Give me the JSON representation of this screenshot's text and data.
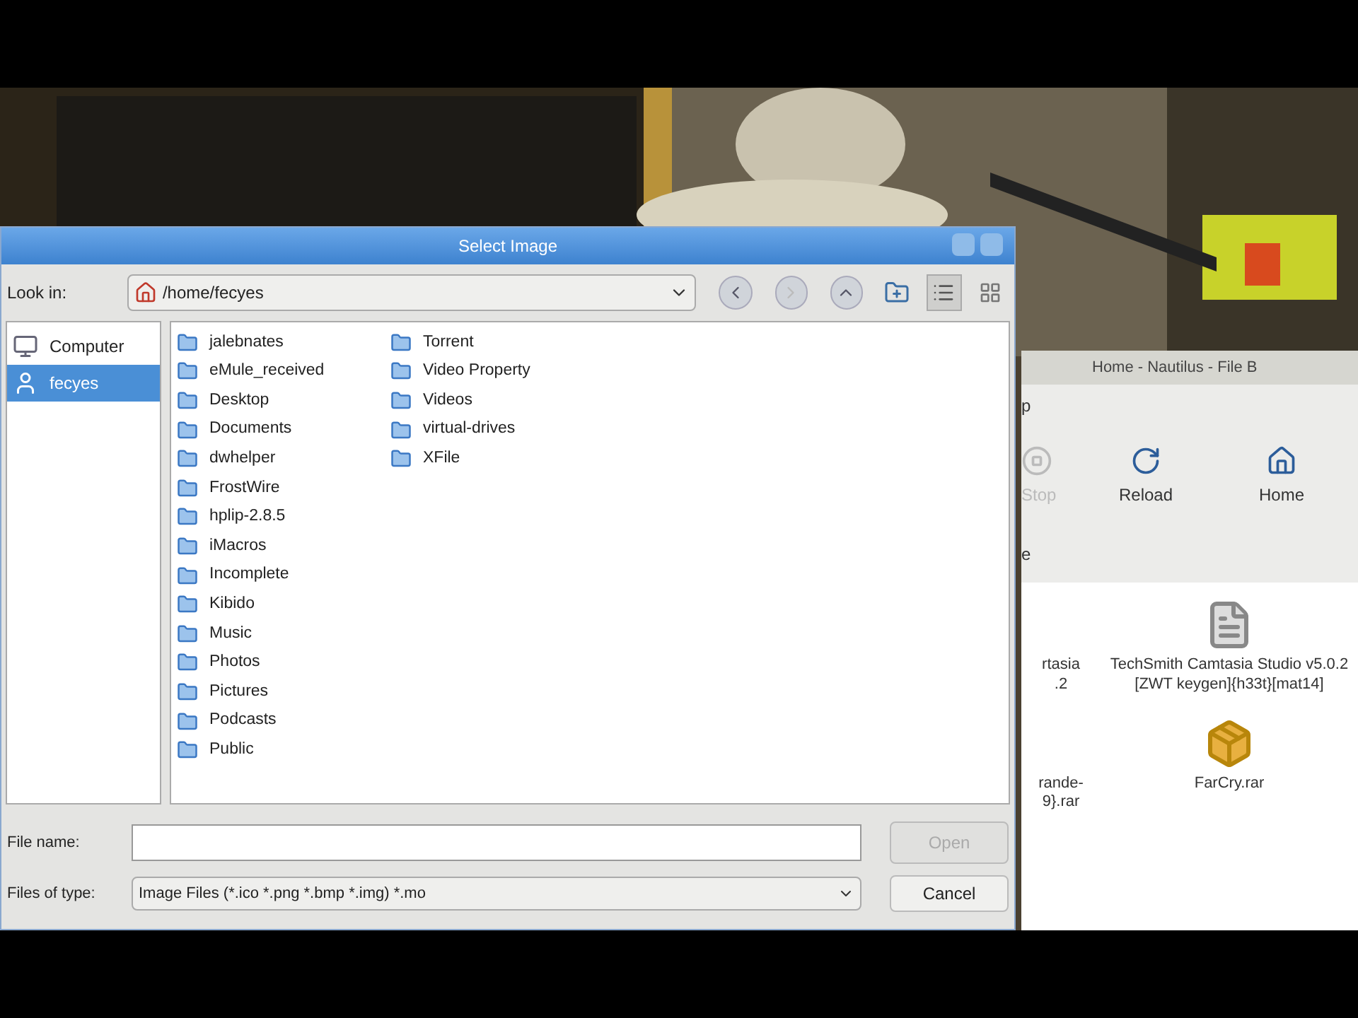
{
  "dialog": {
    "title": "Select Image",
    "look_in_label": "Look in:",
    "path": "/home/fecyes",
    "sidebar": [
      {
        "label": "Computer",
        "kind": "computer",
        "selected": false
      },
      {
        "label": "fecyes",
        "kind": "user",
        "selected": true
      }
    ],
    "columns": [
      [
        "jalebnates",
        "eMule_received",
        "Desktop",
        "Documents",
        "dwhelper",
        "FrostWire",
        "hplip-2.8.5",
        "iMacros",
        "Incomplete",
        "Kibido",
        "Music",
        "Photos",
        "Pictures",
        "Podcasts",
        "Public"
      ],
      [
        "Torrent",
        "Video Property",
        "Videos",
        "virtual-drives",
        "XFile"
      ]
    ],
    "file_name_label": "File name:",
    "file_type_label": "Files of type:",
    "file_type": "Image Files (*.ico *.png *.bmp *.img) *.mo",
    "buttons": [
      {
        "label": "Open",
        "disabled": true
      },
      {
        "label": "Cancel",
        "disabled": false
      }
    ]
  },
  "file_manager": {
    "title": "Home - Nautilus - File B",
    "menu": "p",
    "toolbar": [
      {
        "label": "Stop",
        "kind": "stop",
        "disabled": true
      },
      {
        "label": "Reload",
        "kind": "reload",
        "disabled": false
      },
      {
        "label": "Home",
        "kind": "home",
        "disabled": false
      }
    ],
    "location": "e",
    "files": [
      {
        "label": "rtasia\n.2",
        "kind": "none"
      },
      {
        "label": "TechSmith Camtasia Studio v5.0.2 [ZWT keygen]{h33t}[mat14]",
        "kind": "file"
      },
      {
        "label": "rande-\n9}.rar",
        "kind": "none"
      },
      {
        "label": "FarCry.rar",
        "kind": "archive"
      }
    ]
  }
}
